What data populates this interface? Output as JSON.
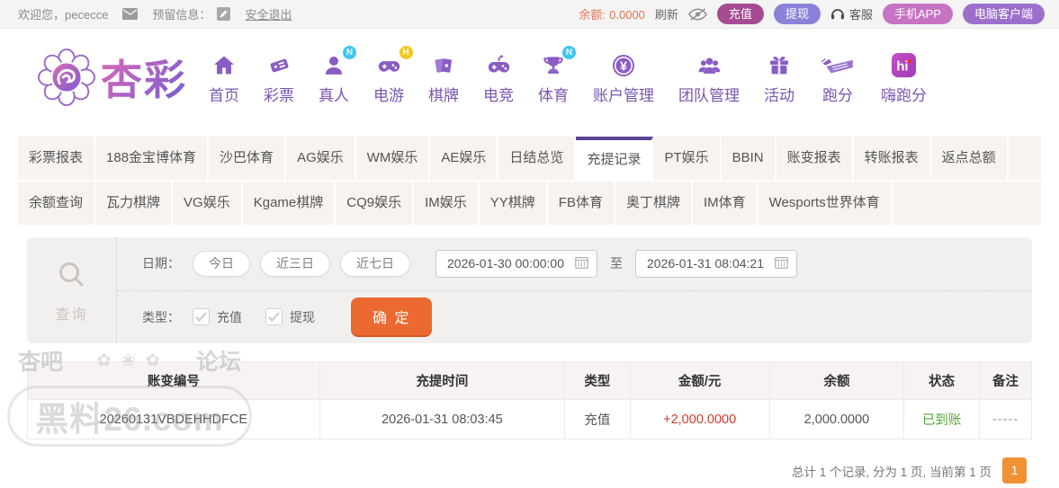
{
  "topbar": {
    "welcome": "欢迎您，pececce",
    "reserved_info_label": "预留信息：",
    "logout": "安全退出",
    "balance_label": "余额:",
    "balance_value": "0.0000",
    "refresh": "刷新",
    "deposit": "充值",
    "withdraw": "提现",
    "service": "客服",
    "mobile_app": "手机APP",
    "pc_client": "电脑客户端"
  },
  "brand": {
    "name": "杏彩"
  },
  "nav": {
    "items": [
      {
        "label": "首页",
        "icon": "home"
      },
      {
        "label": "彩票",
        "icon": "ticket"
      },
      {
        "label": "真人",
        "icon": "live-person",
        "badge": "N",
        "badge_color": "#3ec6f2"
      },
      {
        "label": "电游",
        "icon": "egame-pad",
        "badge": "H",
        "badge_color": "#f5c71f"
      },
      {
        "label": "棋牌",
        "icon": "chess-cards"
      },
      {
        "label": "电竞",
        "icon": "esports-pad"
      },
      {
        "label": "体育",
        "icon": "trophy",
        "badge": "N",
        "badge_color": "#3ec6f2"
      },
      {
        "label": "账户管理",
        "icon": "yen-coin"
      },
      {
        "label": "团队管理",
        "icon": "team"
      },
      {
        "label": "活动",
        "icon": "gift"
      },
      {
        "label": "跑分",
        "icon": "runscore"
      },
      {
        "label": "嗨跑分",
        "icon": "hi-app"
      }
    ]
  },
  "tabs": {
    "active": "充提记录",
    "row1": [
      "彩票报表",
      "188金宝博体育",
      "沙巴体育",
      "AG娱乐",
      "WM娱乐",
      "AE娱乐",
      "日结总览",
      "充提记录",
      "PT娱乐",
      "BBIN",
      "账变报表",
      "转账报表",
      "返点总额"
    ],
    "row2": [
      "余额查询",
      "瓦力棋牌",
      "VG娱乐",
      "Kgame棋牌",
      "CQ9娱乐",
      "IM娱乐",
      "YY棋牌",
      "FB体育",
      "奥丁棋牌",
      "IM体育",
      "Wesports世界体育"
    ]
  },
  "filter": {
    "query_label": "查询",
    "date_label": "日期：",
    "quick_ranges": [
      "今日",
      "近三日",
      "近七日"
    ],
    "date_from": "2026-01-30 00:00:00",
    "to_label": "至",
    "date_to": "2026-01-31 08:04:21",
    "type_label": "类型：",
    "type_options": [
      {
        "label": "充值",
        "checked": true
      },
      {
        "label": "提现",
        "checked": true
      }
    ],
    "submit_label": "确 定"
  },
  "table": {
    "headers": [
      "账变编号",
      "充提时间",
      "类型",
      "金额/元",
      "余额",
      "状态",
      "备注"
    ],
    "rows": [
      [
        "20260131VBDEHHDFCE",
        "2026-01-31 08:03:45",
        "充值",
        "+2,000.0000",
        "2,000.0000",
        "已到账",
        "-----"
      ]
    ]
  },
  "pagination": {
    "summary": "总计 1 个记录, 分为 1 页, 当前第 1 页",
    "current_page": "1"
  },
  "watermark": {
    "top_left": "杏吧",
    "ornament": "✿ ❀ ✿",
    "top_right": "论坛",
    "main": "黑料26.com"
  },
  "colors": {
    "accent_purple": "#8a5cc5",
    "deposit_button": "#a64a92",
    "withdraw_button": "#8a82d8",
    "mobile_button": "#c673c3",
    "pc_button": "#9c6fcc",
    "balance_text": "#e4734d",
    "submit_button": "#eb6a31",
    "page_button": "#f09133",
    "amount_red": "#cf3a2c",
    "status_green": "#56a63a",
    "tab_active_border": "#5b4496"
  }
}
